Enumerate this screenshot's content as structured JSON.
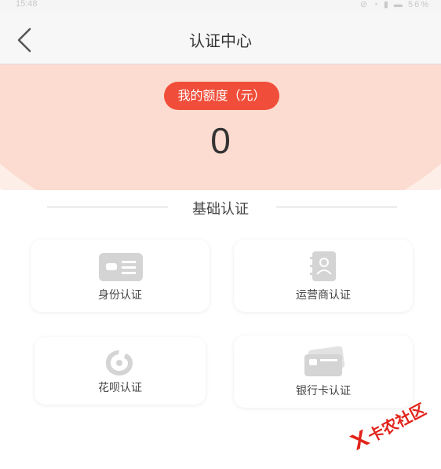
{
  "status_bar": {
    "time": "15:48",
    "right": "⊘ ◔ ▮ ▬ 56%"
  },
  "nav": {
    "title": "认证中心"
  },
  "hero": {
    "quota_label": "我的额度（元）",
    "quota_value": "0"
  },
  "section": {
    "title": "基础认证"
  },
  "cards": [
    {
      "label": "身份认证",
      "icon": "id-card-icon"
    },
    {
      "label": "运营商认证",
      "icon": "contact-book-icon"
    },
    {
      "label": "花呗认证",
      "icon": "huabei-icon"
    },
    {
      "label": "银行卡认证",
      "icon": "bank-card-icon"
    }
  ],
  "watermark": {
    "text": "卡农社区",
    "icon": "kanong-logo-icon"
  },
  "colors": {
    "accent": "#f04e3a",
    "hero_bg": "#fcdcd0",
    "icon_gray": "#d4d4d4"
  }
}
